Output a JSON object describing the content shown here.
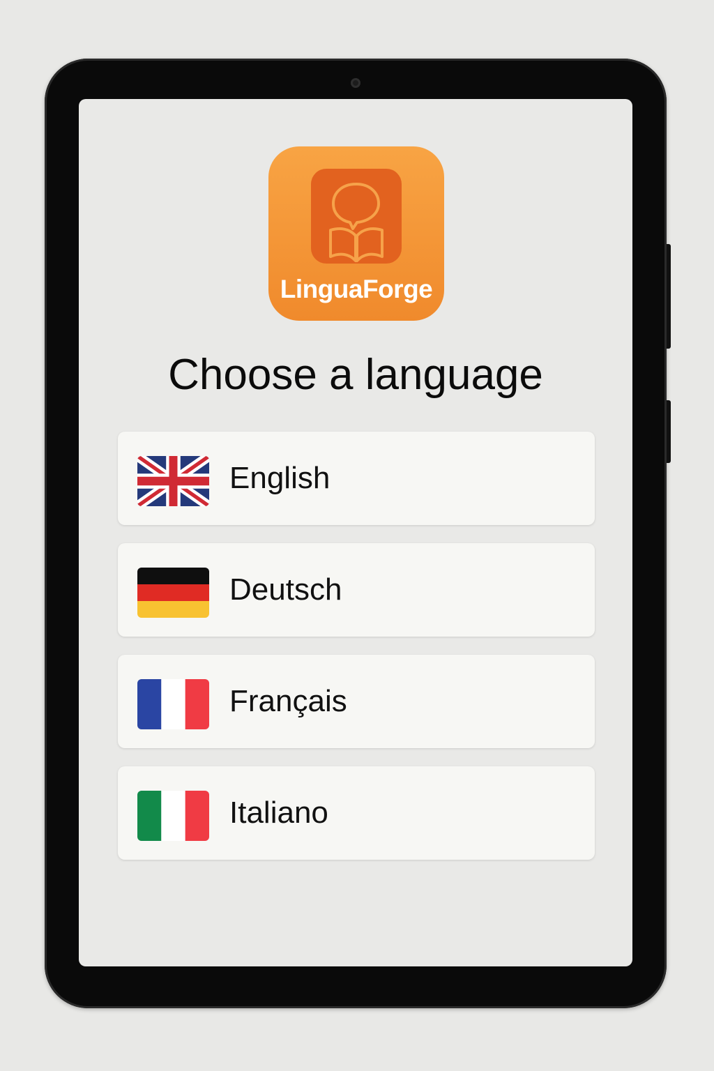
{
  "app": {
    "name": "LinguaForge",
    "logo_icon": "speech-bubble-book-icon",
    "colors": {
      "brand_orange": "#f39434",
      "brand_dark_orange": "#e2621f"
    }
  },
  "screen": {
    "title": "Choose a language"
  },
  "languages": [
    {
      "label": "English",
      "flag_icon": "uk-flag-icon"
    },
    {
      "label": "Deutsch",
      "flag_icon": "germany-flag-icon"
    },
    {
      "label": "Français",
      "flag_icon": "france-flag-icon"
    },
    {
      "label": "Italiano",
      "flag_icon": "italy-flag-icon"
    }
  ]
}
